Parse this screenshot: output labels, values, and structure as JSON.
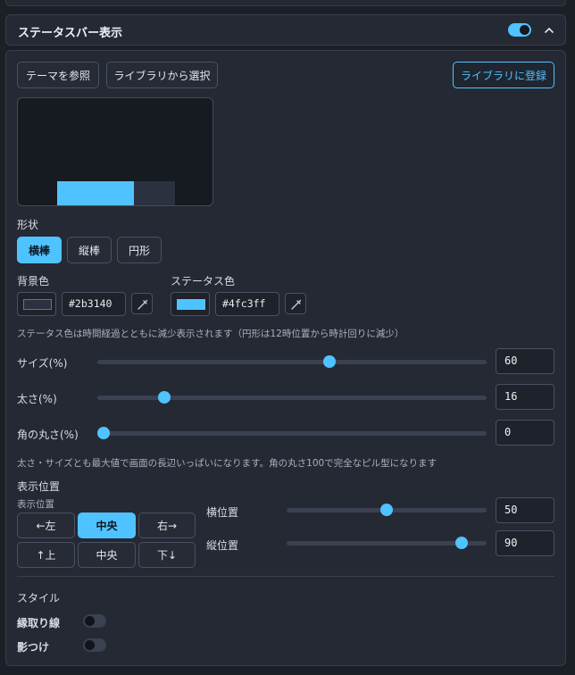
{
  "header": {
    "title": "ステータスバー表示",
    "enabled": true
  },
  "top_buttons": {
    "theme": "テーマを参照",
    "library_select": "ライブラリから選択",
    "library_register": "ライブラリに登録"
  },
  "colors": {
    "accent": "#4fc3ff",
    "panel": "#242934"
  },
  "preview": {
    "background_color": "#2b3140",
    "fill_color": "#4fc3ff",
    "fill_ratio": 0.65
  },
  "shape": {
    "label": "形状",
    "options": [
      "横棒",
      "縦棒",
      "円形"
    ],
    "selected": "横棒"
  },
  "background_color": {
    "label": "背景色",
    "value": "#2b3140"
  },
  "status_color": {
    "label": "ステータス色",
    "value": "#4fc3ff",
    "display_value": "#4fc3ff"
  },
  "status_note": "ステータス色は時間経過とともに減少表示されます（円形は12時位置から時計回りに減少）",
  "size": {
    "label": "サイズ(%)",
    "value": "60",
    "fraction": 0.6
  },
  "thickness": {
    "label": "太さ(%)",
    "value": "16",
    "fraction": 0.16
  },
  "radius": {
    "label": "角の丸さ(%)",
    "value": "0",
    "fraction": 0
  },
  "size_note": "太さ・サイズとも最大値で画面の長辺いっぱいになります。角の丸さ100で完全なピル型になります",
  "position": {
    "section_label": "表示位置",
    "sub_label": "表示位置",
    "buttons": {
      "left": "←左",
      "center_h": "中央",
      "right": "右→",
      "up": "↑上",
      "center_v": "中央",
      "down": "下↓"
    },
    "horizontal": {
      "label": "横位置",
      "value": "50",
      "fraction": 0.5
    },
    "vertical": {
      "label": "縦位置",
      "value": "90",
      "fraction": 0.9
    }
  },
  "style": {
    "section_label": "スタイル",
    "outline": {
      "label": "縁取り線",
      "enabled": false
    },
    "shadow": {
      "label": "影つけ",
      "enabled": false
    }
  },
  "icons": [
    "chevron-up-icon",
    "eyedropper-icon"
  ]
}
